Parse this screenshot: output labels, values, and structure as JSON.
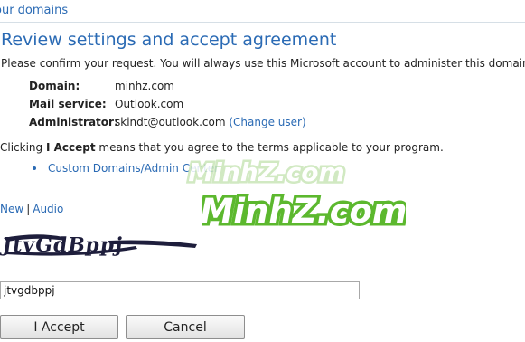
{
  "header": {
    "breadcrumb": "our domains"
  },
  "page": {
    "title": "Review settings and accept agreement",
    "intro": "Please confirm your request. You will always use this Microsoft account to administer this domain."
  },
  "details": {
    "domain_label": "Domain:",
    "domain_value": "minhz.com",
    "mail_label": "Mail service:",
    "mail_value": "Outlook.com",
    "admin_label": "Administrator:",
    "admin_value": "skindt@outlook.com",
    "change_user": "(Change user)"
  },
  "terms": {
    "prefix": "Clicking ",
    "bold": "I Accept",
    "suffix": " means that you agree to the terms applicable to your program."
  },
  "links": {
    "custom_domains": "Custom Domains/Admin Center"
  },
  "captcha": {
    "new_label": "New",
    "separator": "|",
    "audio_label": "Audio",
    "image_text": "JtvGdBppj",
    "input_value": "jtvgdbppj"
  },
  "watermark": {
    "text1": "MinhZ.com",
    "text2": "MinhZ.com"
  },
  "buttons": {
    "accept": "I Accept",
    "cancel": "Cancel"
  },
  "colors": {
    "link": "#2a6ab4",
    "watermark_green": "#5cb82e"
  }
}
